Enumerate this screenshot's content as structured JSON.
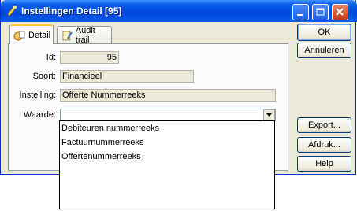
{
  "window": {
    "title": "Instellingen Detail [95]"
  },
  "tabs": [
    {
      "label": "Detail",
      "icon": "detail-icon",
      "active": true
    },
    {
      "label": "Audit trail",
      "icon": "audit-trail-icon",
      "active": false
    }
  ],
  "form": {
    "id_label": "Id:",
    "id_value": "95",
    "soort_label": "Soort:",
    "soort_value": "Financieel",
    "instelling_label": "Instelling:",
    "instelling_value": "Offerte Nummerreeks",
    "waarde_label": "Waarde:",
    "waarde_value": ""
  },
  "dropdown": {
    "options": [
      "Debiteuren nummerreeks",
      "Factuurnummerreeks",
      "Offertenummerreeks"
    ]
  },
  "buttons": {
    "ok": "OK",
    "annuleren": "Annuleren",
    "export": "Export...",
    "afdruk": "Afdruk...",
    "help": "Help"
  },
  "colors": {
    "titlebar": "#0a5ee8",
    "dialog_bg": "#ece9d8",
    "active_tab_highlight": "#ffc83c"
  }
}
